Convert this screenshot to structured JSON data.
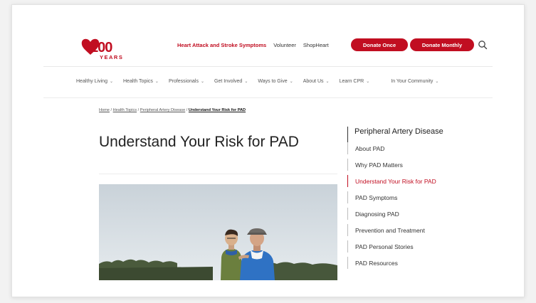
{
  "header": {
    "logo": {
      "number": "100",
      "word": "YEARS"
    },
    "utility_links": [
      "Heart Attack and Stroke Symptoms",
      "Volunteer",
      "ShopHeart"
    ],
    "donate_once": "Donate Once",
    "donate_monthly": "Donate Monthly",
    "search_icon": "search-icon",
    "brand_color": "#c10e21"
  },
  "nav": {
    "items": [
      "Healthy Living",
      "Health Topics",
      "Professionals",
      "Get Involved",
      "Ways to Give",
      "About Us",
      "Learn CPR",
      "In Your Community"
    ],
    "chevron": "⌄"
  },
  "breadcrumb": {
    "items": [
      "Home",
      "Health Topics",
      "Peripheral Artery Disease"
    ],
    "separator": "/",
    "current": "Understand Your Risk for PAD"
  },
  "main": {
    "title": "Understand Your Risk for PAD"
  },
  "sidebar": {
    "heading": "Peripheral Artery Disease",
    "items": [
      "About PAD",
      "Why PAD Matters",
      "Understand Your Risk for PAD",
      "PAD Symptoms",
      "Diagnosing PAD",
      "Prevention and Treatment",
      "PAD Personal Stories",
      "PAD Resources"
    ],
    "active_index": 2
  }
}
